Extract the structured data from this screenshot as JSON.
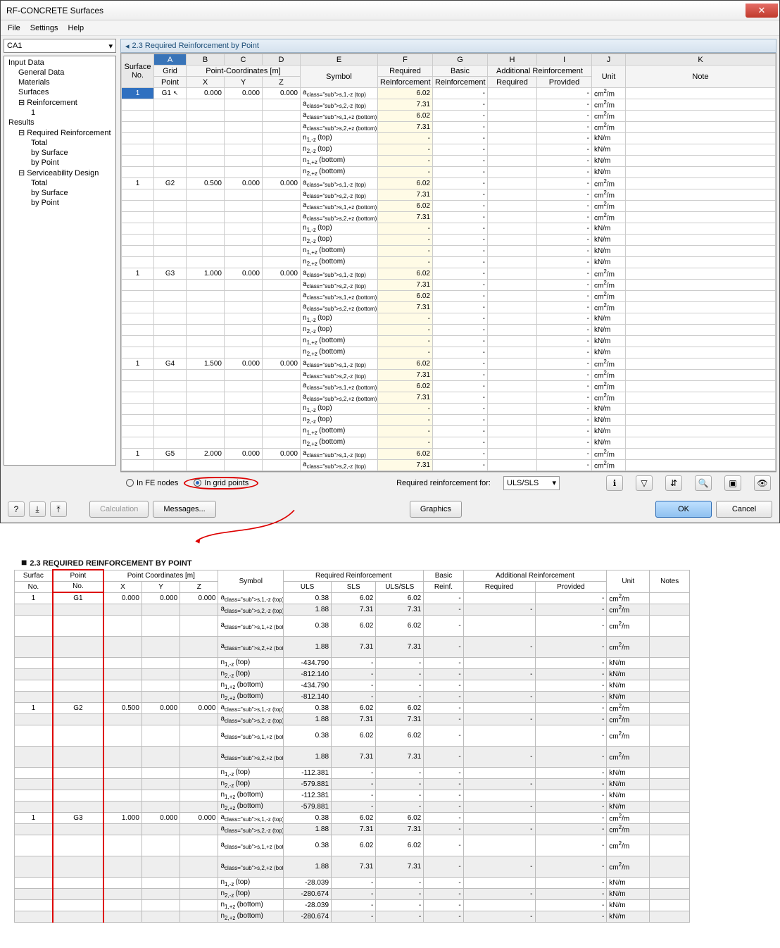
{
  "window": {
    "title": "RF-CONCRETE Surfaces"
  },
  "menu": {
    "file": "File",
    "settings": "Settings",
    "help": "Help"
  },
  "case": {
    "value": "CA1"
  },
  "tree": {
    "input": "Input Data",
    "general": "General Data",
    "materials": "Materials",
    "surfaces": "Surfaces",
    "reinf": "Reinforcement",
    "reinf1": "1",
    "results": "Results",
    "reqreinf": "Required Reinforcement",
    "total": "Total",
    "bysurface": "by Surface",
    "bypoint": "by Point",
    "serv": "Serviceability Design",
    "stotal": "Total",
    "sbysurface": "by Surface",
    "sbypoint": "by Point"
  },
  "section": {
    "title": "2.3 Required Reinforcement by Point"
  },
  "cols": {
    "A": "A",
    "B": "B",
    "C": "C",
    "D": "D",
    "E": "E",
    "F": "F",
    "G": "G",
    "H": "H",
    "I": "I",
    "J": "J",
    "K": "K",
    "surfno": "Surface",
    "no": "No.",
    "grid": "Grid",
    "point": "Point",
    "coords": "Point-Coordinates [m]",
    "X": "X",
    "Y": "Y",
    "Z": "Z",
    "symbol": "Symbol",
    "required": "Required",
    "reinforcement": "Reinforcement",
    "basic": "Basic",
    "additional": "Additional",
    "provided": "Provided",
    "unit": "Unit",
    "note": "Note"
  },
  "symbols": {
    "as1t": "a s,1,-z (top)",
    "as2t": "a s,2,-z (top)",
    "as1b": "a s,1,+z (bottom)",
    "as2b": "a s,2,+z (bottom)",
    "n1t": "n 1,-z (top)",
    "n2t": "n 2,-z (top)",
    "n1b": "n 1,+z (bottom)",
    "n2b": "n 2,+z (bottom)",
    "as1zb": "a s,1,+z (bottom)",
    "as2zb": "a s,2,+z (bottom)"
  },
  "units": {
    "cm2m": "cm2/m",
    "knm": "kN/m"
  },
  "vals": {
    "v602": "6.02",
    "v731": "7.31",
    "dash": "-"
  },
  "groups": [
    {
      "surf": "1",
      "pt": "G1",
      "x": "0.000",
      "y": "0.000",
      "z": "0.000"
    },
    {
      "surf": "1",
      "pt": "G2",
      "x": "0.500",
      "y": "0.000",
      "z": "0.000"
    },
    {
      "surf": "1",
      "pt": "G3",
      "x": "1.000",
      "y": "0.000",
      "z": "0.000"
    },
    {
      "surf": "1",
      "pt": "G4",
      "x": "1.500",
      "y": "0.000",
      "z": "0.000"
    },
    {
      "surf": "1",
      "pt": "G5",
      "x": "2.000",
      "y": "0.000",
      "z": "0.000"
    }
  ],
  "bb": {
    "fe": "In FE nodes",
    "grid": "In grid points",
    "reqfor": "Required reinforcement for:",
    "combo": "ULS/SLS"
  },
  "footer": {
    "calc": "Calculation",
    "msg": "Messages...",
    "gfx": "Graphics",
    "ok": "OK",
    "cancel": "Cancel"
  },
  "report": {
    "title": "2.3 REQUIRED REINFORCEMENT BY POINT",
    "hdr": {
      "surfac": "Surfac",
      "no": "No.",
      "point": "Point",
      "coords": "Point Coordinates [m]",
      "X": "X",
      "Y": "Y",
      "Z": "Z",
      "symbol": "Symbol",
      "reqreinf": "Required Reinforcement",
      "uls": "ULS",
      "sls": "SLS",
      "ulssls": "ULS/SLS",
      "basic": "Basic",
      "reinf": "Reinf.",
      "addreinf": "Additional Reinforcement",
      "required": "Required",
      "provided": "Provided",
      "unit": "Unit",
      "notes": "Notes"
    },
    "rows": [
      {
        "surf": "1",
        "pt": "G1",
        "x": "0.000",
        "y": "0.000",
        "z": "0.000",
        "sym": "a s,1,-z (top)",
        "uls": "0.38",
        "sls": "6.02",
        "us": "6.02",
        "basic": "-",
        "req": "",
        "prov": "-",
        "unit": "cm2/m",
        "alt": 0
      },
      {
        "sym": "a s,2,-z (top)",
        "uls": "1.88",
        "sls": "7.31",
        "us": "7.31",
        "basic": "-",
        "req": "-",
        "prov": "-",
        "unit": "cm2/m",
        "alt": 1
      },
      {
        "sym": "a s,1,+z (bottom)",
        "uls": "0.38",
        "sls": "6.02",
        "us": "6.02",
        "basic": "-",
        "req": "",
        "prov": "-",
        "unit": "cm2/m",
        "alt": 0,
        "h2": 1
      },
      {
        "sym": "a s,2,+z (bottom)",
        "uls": "1.88",
        "sls": "7.31",
        "us": "7.31",
        "basic": "-",
        "req": "-",
        "prov": "-",
        "unit": "cm2/m",
        "alt": 1,
        "h2": 1
      },
      {
        "sym": "n 1,-z (top)",
        "uls": "-434.790",
        "sls": "-",
        "us": "-",
        "basic": "-",
        "req": "",
        "prov": "-",
        "unit": "kN/m",
        "alt": 0
      },
      {
        "sym": "n 2,-z (top)",
        "uls": "-812.140",
        "sls": "-",
        "us": "-",
        "basic": "-",
        "req": "-",
        "prov": "-",
        "unit": "kN/m",
        "alt": 1
      },
      {
        "sym": "n 1,+z (bottom)",
        "uls": "-434.790",
        "sls": "-",
        "us": "-",
        "basic": "-",
        "req": "",
        "prov": "-",
        "unit": "kN/m",
        "alt": 0
      },
      {
        "sym": "n 2,+z (bottom)",
        "uls": "-812.140",
        "sls": "-",
        "us": "-",
        "basic": "-",
        "req": "-",
        "prov": "-",
        "unit": "kN/m",
        "alt": 1
      },
      {
        "surf": "1",
        "pt": "G2",
        "x": "0.500",
        "y": "0.000",
        "z": "0.000",
        "sym": "a s,1,-z (top)",
        "uls": "0.38",
        "sls": "6.02",
        "us": "6.02",
        "basic": "-",
        "req": "",
        "prov": "-",
        "unit": "cm2/m",
        "alt": 0
      },
      {
        "sym": "a s,2,-z (top)",
        "uls": "1.88",
        "sls": "7.31",
        "us": "7.31",
        "basic": "-",
        "req": "-",
        "prov": "-",
        "unit": "cm2/m",
        "alt": 1
      },
      {
        "sym": "a s,1,+z (bottom)",
        "uls": "0.38",
        "sls": "6.02",
        "us": "6.02",
        "basic": "-",
        "req": "",
        "prov": "-",
        "unit": "cm2/m",
        "alt": 0,
        "h2": 1
      },
      {
        "sym": "a s,2,+z (bottom)",
        "uls": "1.88",
        "sls": "7.31",
        "us": "7.31",
        "basic": "-",
        "req": "-",
        "prov": "-",
        "unit": "cm2/m",
        "alt": 1,
        "h2": 1
      },
      {
        "sym": "n 1,-z (top)",
        "uls": "-112.381",
        "sls": "-",
        "us": "-",
        "basic": "-",
        "req": "",
        "prov": "-",
        "unit": "kN/m",
        "alt": 0
      },
      {
        "sym": "n 2,-z (top)",
        "uls": "-579.881",
        "sls": "-",
        "us": "-",
        "basic": "-",
        "req": "-",
        "prov": "-",
        "unit": "kN/m",
        "alt": 1
      },
      {
        "sym": "n 1,+z (bottom)",
        "uls": "-112.381",
        "sls": "-",
        "us": "-",
        "basic": "-",
        "req": "",
        "prov": "-",
        "unit": "kN/m",
        "alt": 0
      },
      {
        "sym": "n 2,+z (bottom)",
        "uls": "-579.881",
        "sls": "-",
        "us": "-",
        "basic": "-",
        "req": "-",
        "prov": "-",
        "unit": "kN/m",
        "alt": 1
      },
      {
        "surf": "1",
        "pt": "G3",
        "x": "1.000",
        "y": "0.000",
        "z": "0.000",
        "sym": "a s,1,-z (top)",
        "uls": "0.38",
        "sls": "6.02",
        "us": "6.02",
        "basic": "-",
        "req": "",
        "prov": "-",
        "unit": "cm2/m",
        "alt": 0
      },
      {
        "sym": "a s,2,-z (top)",
        "uls": "1.88",
        "sls": "7.31",
        "us": "7.31",
        "basic": "-",
        "req": "-",
        "prov": "-",
        "unit": "cm2/m",
        "alt": 1
      },
      {
        "sym": "a s,1,+z (bottom)",
        "uls": "0.38",
        "sls": "6.02",
        "us": "6.02",
        "basic": "-",
        "req": "",
        "prov": "-",
        "unit": "cm2/m",
        "alt": 0,
        "h2": 1
      },
      {
        "sym": "a s,2,+z (bottom)",
        "uls": "1.88",
        "sls": "7.31",
        "us": "7.31",
        "basic": "-",
        "req": "-",
        "prov": "-",
        "unit": "cm2/m",
        "alt": 1,
        "h2": 1
      },
      {
        "sym": "n 1,-z (top)",
        "uls": "-28.039",
        "sls": "-",
        "us": "-",
        "basic": "-",
        "req": "",
        "prov": "-",
        "unit": "kN/m",
        "alt": 0
      },
      {
        "sym": "n 2,-z (top)",
        "uls": "-280.674",
        "sls": "-",
        "us": "-",
        "basic": "-",
        "req": "-",
        "prov": "-",
        "unit": "kN/m",
        "alt": 1
      },
      {
        "sym": "n 1,+z (bottom)",
        "uls": "-28.039",
        "sls": "-",
        "us": "-",
        "basic": "-",
        "req": "",
        "prov": "-",
        "unit": "kN/m",
        "alt": 0
      },
      {
        "sym": "n 2,+z (bottom)",
        "uls": "-280.674",
        "sls": "-",
        "us": "-",
        "basic": "-",
        "req": "-",
        "prov": "-",
        "unit": "kN/m",
        "alt": 1
      }
    ]
  }
}
